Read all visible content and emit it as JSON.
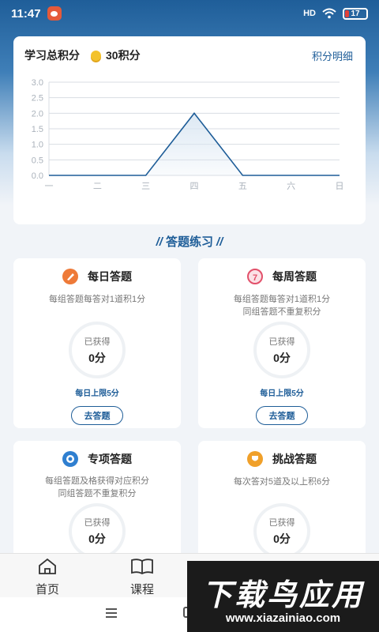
{
  "status_bar": {
    "time": "11:47",
    "network": "HD",
    "battery": "17"
  },
  "score_card": {
    "title": "学习总积分",
    "points": "30积分",
    "detail_link": "积分明细"
  },
  "chart_data": {
    "type": "line",
    "categories": [
      "一",
      "二",
      "三",
      "四",
      "五",
      "六",
      "日"
    ],
    "series": [
      {
        "values": [
          0,
          0,
          0,
          2.0,
          0,
          0,
          0
        ]
      }
    ],
    "y_ticks": [
      "0.0",
      "0.5",
      "1.0",
      "1.5",
      "2.0",
      "2.5",
      "3.0"
    ],
    "ylim": [
      0,
      3
    ],
    "grid": true,
    "line_color": "#1e5d98",
    "area_fill": "#d9e6f2"
  },
  "section_title": "答题练习",
  "section_slash": "//",
  "cards": [
    {
      "name": "每日答题",
      "icon": "daily-quiz-icon",
      "icon_color": "#ee7a38",
      "desc": [
        "每组答题每答对1道积1分"
      ],
      "got_label": "已获得",
      "score": "0分",
      "limit": "每日上限5分",
      "button": "去答题"
    },
    {
      "name": "每周答题",
      "icon": "weekly-quiz-icon",
      "icon_color": "#e2506a",
      "desc": [
        "每组答题每答对1道积1分",
        "同组答题不重复积分"
      ],
      "got_label": "已获得",
      "score": "0分",
      "limit": "每日上限5分",
      "button": "去答题"
    },
    {
      "name": "专项答题",
      "icon": "special-quiz-icon",
      "icon_color": "#2f7fd0",
      "desc": [
        "每组答题及格获得对应积分",
        "同组答题不重复积分"
      ],
      "got_label": "已获得",
      "score": "0分"
    },
    {
      "name": "挑战答题",
      "icon": "challenge-quiz-icon",
      "icon_color": "#f0a02a",
      "desc": [
        "每次答对5道及以上积6分"
      ],
      "got_label": "已获得",
      "score": "0分"
    }
  ],
  "bottom_nav": [
    {
      "label": "首页",
      "icon": "home-icon"
    },
    {
      "label": "课程",
      "icon": "book-icon"
    }
  ],
  "watermark": {
    "title": "下载鸟应用",
    "url": "www.xiazainiao.com"
  }
}
